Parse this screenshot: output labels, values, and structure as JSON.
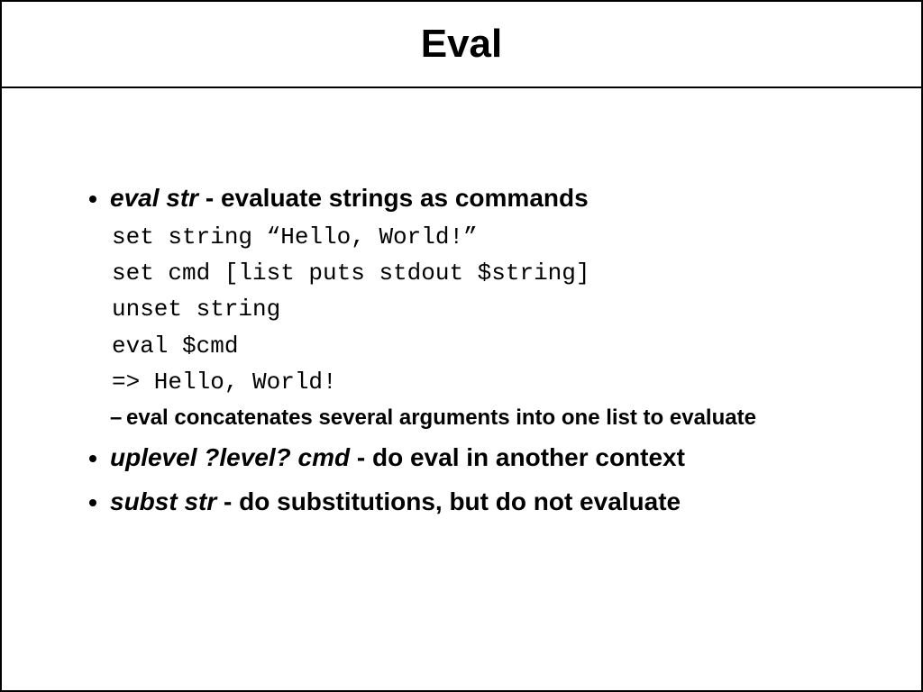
{
  "title": "Eval",
  "bullets": [
    {
      "cmd": "eval str",
      "desc": " - evaluate strings as commands",
      "code": [
        "set string “Hello, World!”",
        "set cmd [list puts stdout $string]",
        "unset string",
        "eval $cmd",
        "=> Hello, World!"
      ],
      "sub": [
        "eval concatenates several arguments into one list to evaluate"
      ]
    },
    {
      "cmd": "uplevel ?level? cmd",
      "desc": " - do eval in another context"
    },
    {
      "cmd": "subst str",
      "desc": " - do substitutions, but do not evaluate"
    }
  ]
}
